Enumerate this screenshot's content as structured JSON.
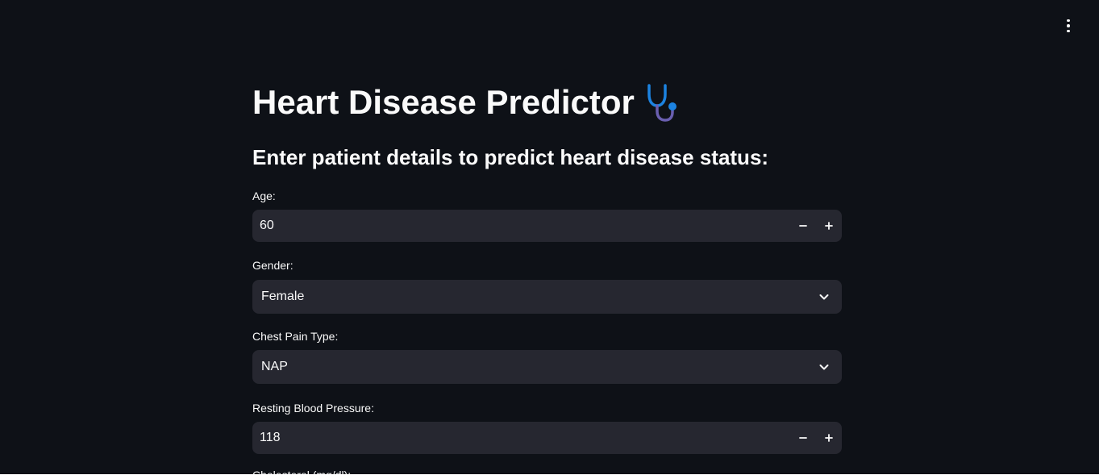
{
  "header": {
    "menu_icon": "vertical-ellipsis-icon"
  },
  "main": {
    "title": "Heart Disease Predictor",
    "title_icon": "stethoscope-icon",
    "subtitle": "Enter patient details to predict heart disease status:",
    "fields": {
      "age": {
        "label": "Age:",
        "value": "60"
      },
      "gender": {
        "label": "Gender:",
        "value": "Female"
      },
      "chest_pain": {
        "label": "Chest Pain Type:",
        "value": "NAP"
      },
      "resting_bp": {
        "label": "Resting Blood Pressure:",
        "value": "118"
      },
      "cholesterol": {
        "label": "Cholesterol (mg/dl):"
      }
    }
  },
  "colors": {
    "background": "#0e1117",
    "input_bg": "#262730",
    "text": "#fafafa",
    "icon_blue": "#1c83e1",
    "icon_purple": "#6a5fb0"
  }
}
